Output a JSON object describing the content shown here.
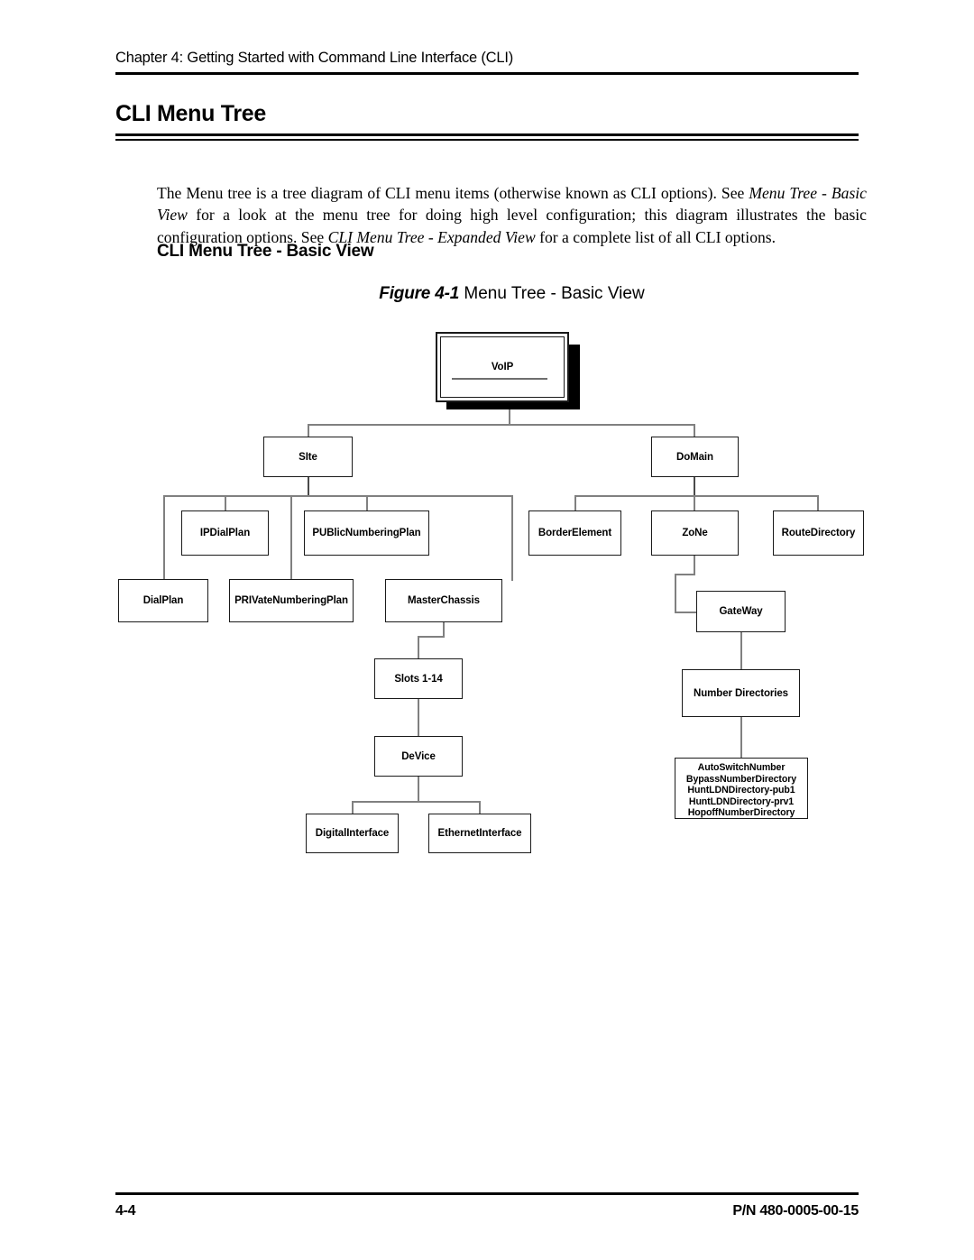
{
  "header": {
    "running_header": "Chapter 4: Getting Started with Command Line Interface (CLI)",
    "page_title": "CLI Menu Tree"
  },
  "intro": {
    "part1": "The Menu tree is a tree diagram of CLI menu items (otherwise known as CLI options). See ",
    "italic1": "Menu Tree - Basic View",
    "part2": " for a look at the menu tree for doing high level configuration; this diagram illustrates the basic configuration options. See ",
    "italic2": "CLI Menu Tree - Expanded View",
    "part3": " for a complete list of all CLI options."
  },
  "sub_heading": "CLI Menu Tree - Basic View",
  "figure": {
    "number": "Figure 4-1",
    "caption": " Menu Tree - Basic View"
  },
  "diagram": {
    "nodes": {
      "voip": "VoIP",
      "site": "SIte",
      "domain": "DoMain",
      "ipdialplan": "IPDialPlan",
      "publicnumberingplan": "PUBlicNumberingPlan",
      "dialplan": "DialPlan",
      "privatenumberingplan": "PRIVateNumberingPlan",
      "masterchassis": "MasterChassis",
      "slots": "Slots 1-14",
      "device": "DeVice",
      "digitalinterface": "DigitalInterface",
      "ethernetinterface": "EthernetInterface",
      "borderelement": "BorderElement",
      "zone": "ZoNe",
      "routedirectory": "RouteDirectory",
      "gateway": "GateWay",
      "numberdirectories": "Number Directories",
      "numberlist": [
        "AutoSwitchNumber",
        "BypassNumberDirectory",
        "HuntLDNDirectory-pub1",
        "HuntLDNDirectory-prv1",
        "HopoffNumberDirectory"
      ]
    }
  },
  "footer": {
    "page_number": "4-4",
    "part_number": "P/N 480-0005-00-15"
  },
  "colors": {
    "text": "#000000",
    "box_border": "#1a1a1a",
    "connector": "#808080",
    "shadow": "#000000",
    "background": "#ffffff"
  }
}
